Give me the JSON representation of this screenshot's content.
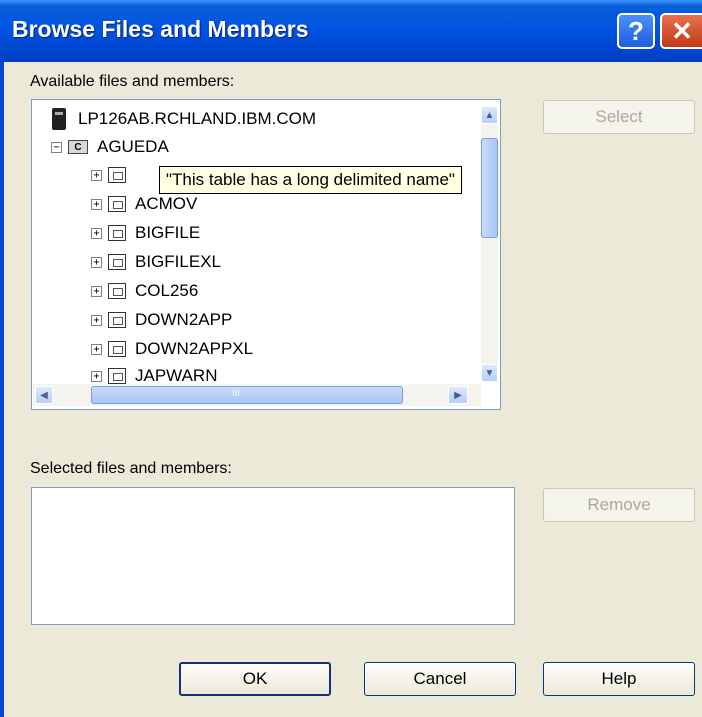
{
  "window": {
    "title": "Browse Files and Members",
    "help_glyph": "?",
    "close_glyph": "✕"
  },
  "available": {
    "label": "Available files and members:",
    "tree": {
      "system": "LP126AB.RCHLAND.IBM.COM",
      "library": "AGUEDA",
      "library_icon_letter": "C",
      "tooltip": "\"This table has a long delimited name\"",
      "files": [
        "ACMOV",
        "BIGFILE",
        "BIGFILEXL",
        "COL256",
        "DOWN2APP",
        "DOWN2APPXL",
        "JAPWARN"
      ]
    }
  },
  "selected": {
    "label": "Selected files and members:"
  },
  "buttons": {
    "select": "Select",
    "remove": "Remove",
    "ok": "OK",
    "cancel": "Cancel",
    "help": "Help"
  },
  "scroll_glyphs": {
    "up": "▲",
    "down": "▼",
    "left": "◀",
    "right": "▶",
    "grip": "III"
  }
}
